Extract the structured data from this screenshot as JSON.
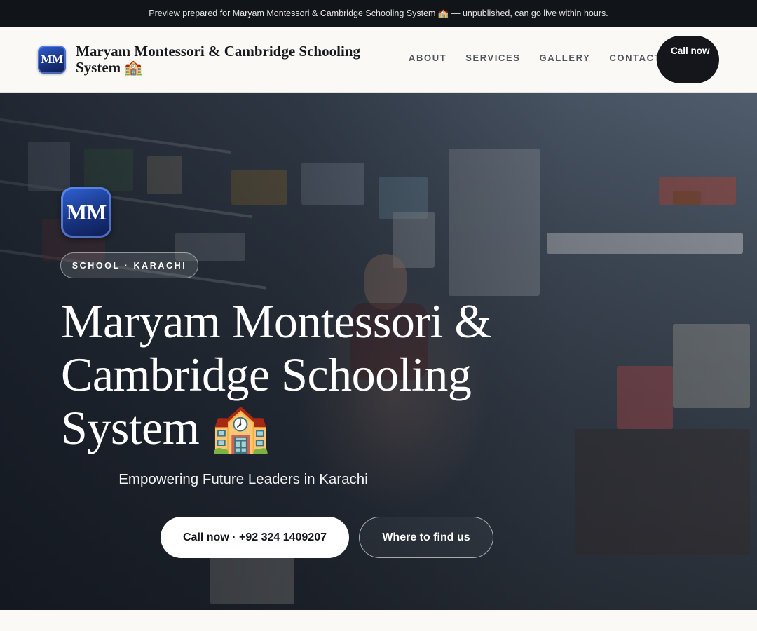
{
  "preview_bar": {
    "text": "Preview prepared for Maryam Montessori & Cambridge Schooling System 🏫 — unpublished, can go live within hours."
  },
  "header": {
    "logo_initials": "MM",
    "brand_name": "Maryam Montessori & Cambridge Schooling System 🏫",
    "nav": [
      {
        "label": "ABOUT"
      },
      {
        "label": "SERVICES"
      },
      {
        "label": "GALLERY"
      },
      {
        "label": "CONTACT"
      }
    ],
    "cta_label": "Call now"
  },
  "hero": {
    "logo_initials": "MM",
    "tag": "SCHOOL · KARACHI",
    "title": "Maryam Montessori & Cambridge Schooling System 🏫",
    "subtitle": "Empowering Future Leaders in Karachi",
    "primary_button": "Call now · +92 324 1409207",
    "secondary_button": "Where to find us"
  },
  "colors": {
    "dark": "#111418",
    "logo_blue": "#17307a",
    "page_bg": "#faf9f6"
  }
}
